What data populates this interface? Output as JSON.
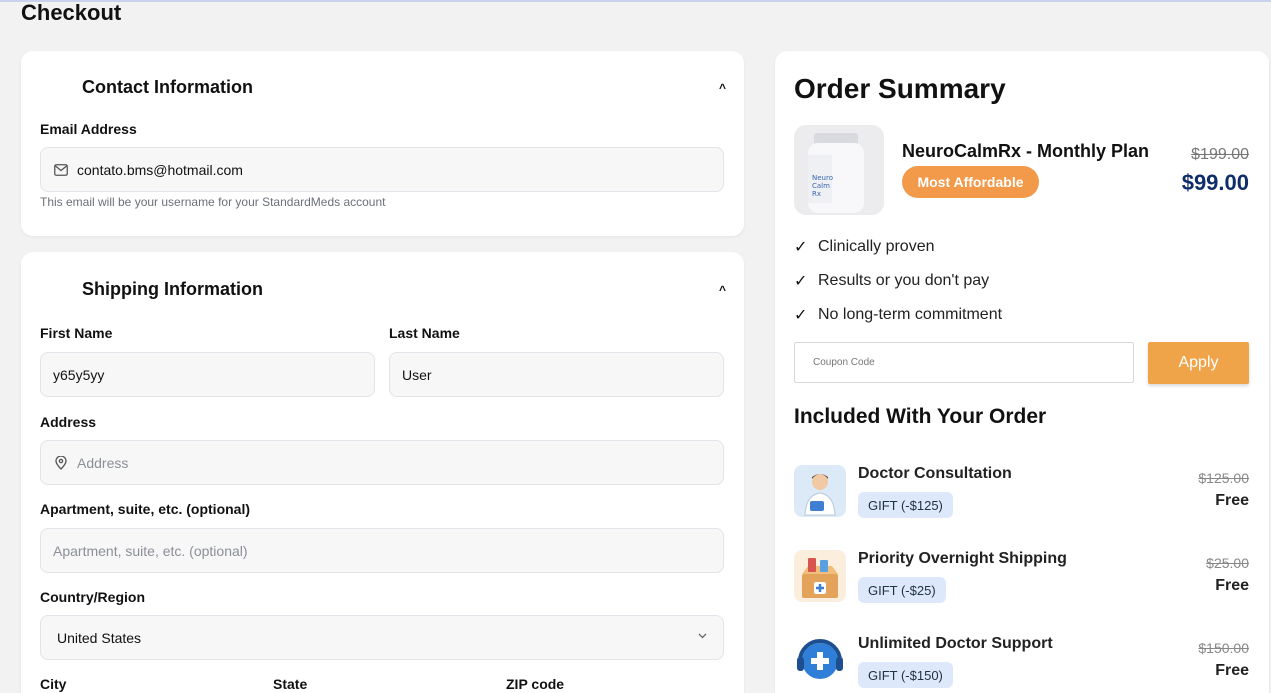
{
  "page": {
    "title": "Checkout"
  },
  "contact": {
    "title": "Contact Information",
    "email_label": "Email Address",
    "email_value": "contato.bms@hotmail.com",
    "email_helper": "This email will be your username for your StandardMeds account"
  },
  "shipping": {
    "title": "Shipping Information",
    "first_name_label": "First Name",
    "first_name_value": "y65y5yy",
    "last_name_label": "Last Name",
    "last_name_value": "User",
    "address_label": "Address",
    "address_placeholder": "Address",
    "apt_label": "Apartment, suite, etc. (optional)",
    "apt_placeholder": "Apartment, suite, etc. (optional)",
    "country_label": "Country/Region",
    "country_value": "United States",
    "city_label": "City",
    "state_label": "State",
    "zip_label": "ZIP code"
  },
  "summary": {
    "title": "Order Summary",
    "product": {
      "name": "NeuroCalmRx - Monthly Plan",
      "badge": "Most Affordable",
      "old_price": "$199.00",
      "new_price": "$99.00",
      "bottle_label": "Neuro\nCalm\nRx"
    },
    "features": [
      "Clinically proven",
      "Results or you don't pay",
      "No long-term commitment"
    ],
    "coupon_placeholder": "Coupon Code",
    "apply_label": "Apply",
    "included_title": "Included With Your Order",
    "included": [
      {
        "name": "Doctor Consultation",
        "gift": "GIFT (-$125)",
        "old_price": "$125.00",
        "price": "Free"
      },
      {
        "name": "Priority Overnight Shipping",
        "gift": "GIFT (-$25)",
        "old_price": "$25.00",
        "price": "Free"
      },
      {
        "name": "Unlimited Doctor Support",
        "gift": "GIFT (-$150)",
        "old_price": "$150.00",
        "price": "Free"
      }
    ]
  },
  "colors": {
    "accent": "#f2994a",
    "price_blue": "#0f2d6b",
    "gift_bg": "#dde8fb"
  },
  "icons": {
    "email": "mail-icon",
    "address": "location-pin-icon",
    "collapse": "chevron-up-icon",
    "select": "chevron-down-icon",
    "check": "checkmark-icon"
  }
}
